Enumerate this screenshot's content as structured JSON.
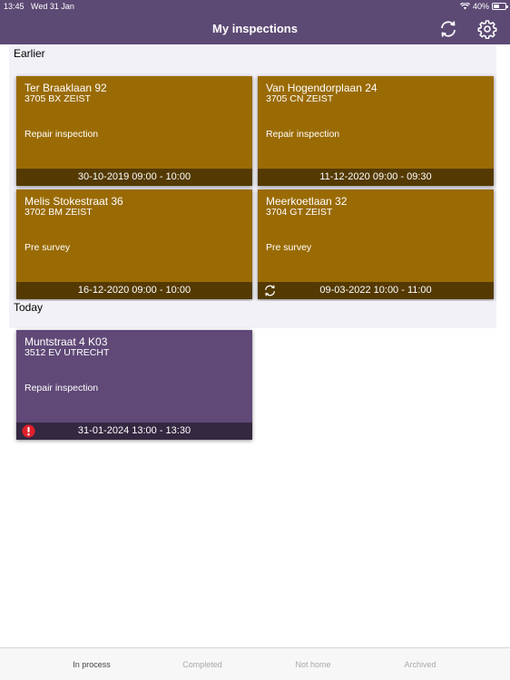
{
  "status_bar": {
    "time": "13:45",
    "date": "Wed 31 Jan",
    "battery": "40%"
  },
  "header": {
    "title": "My inspections"
  },
  "sections": {
    "earlier": {
      "title": "Earlier",
      "cards": [
        {
          "street": "Ter Braaklaan 92",
          "postal": "3705 BX  ZEIST",
          "type": "Repair inspection",
          "datetime": "30-10-2019  09:00 - 10:00"
        },
        {
          "street": "Van Hogendorplaan 24",
          "postal": "3705 CN  ZEIST",
          "type": "Repair inspection",
          "datetime": "11-12-2020  09:00 - 09:30"
        },
        {
          "street": "Melis Stokestraat 36",
          "postal": "3702 BM  ZEIST",
          "type": "Pre survey",
          "datetime": "16-12-2020  09:00 - 10:00"
        },
        {
          "street": "Meerkoetlaan 32",
          "postal": "3704 GT  ZEIST",
          "type": "Pre survey",
          "datetime": "09-03-2022  10:00 - 11:00",
          "footer_icon": "sync-icon"
        }
      ]
    },
    "today": {
      "title": "Today",
      "cards": [
        {
          "street": "Muntstraat 4 K03",
          "postal": "3512 EV  UTRECHT",
          "type": "Repair inspection",
          "datetime": "31-01-2024  13:00 - 13:30",
          "footer_icon": "alert-icon"
        }
      ]
    }
  },
  "tabs": [
    {
      "label": "In process",
      "active": true
    },
    {
      "label": "Completed",
      "active": false
    },
    {
      "label": "Not home",
      "active": false
    },
    {
      "label": "Archived",
      "active": false
    }
  ],
  "colors": {
    "header": "#5c4a74",
    "card_earlier": "#9a6b04",
    "card_today": "#604977",
    "alert": "#e0202a"
  }
}
